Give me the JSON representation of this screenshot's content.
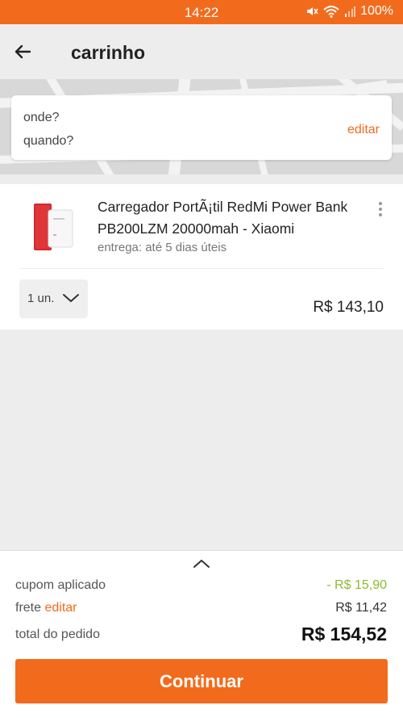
{
  "status_bar": {
    "time": "14:22",
    "battery": "100%"
  },
  "header": {
    "title": "carrinho",
    "back_icon": "arrow-left-icon"
  },
  "location": {
    "where_label": "onde?",
    "when_label": "quando?",
    "edit_label": "editar"
  },
  "product": {
    "name": "Carregador PortÃ¡til RedMi Power Bank PB200LZM 20000mah - Xiaomi",
    "delivery": "entrega: até 5 dias úteis",
    "quantity": "1 un.",
    "price": "R$ 143,10"
  },
  "summary": {
    "coupon_label": "cupom aplicado",
    "coupon_value": "- R$ 15,90",
    "shipping_label": "frete",
    "shipping_edit": "editar",
    "shipping_value": "R$ 11,42",
    "total_label": "total do pedido",
    "total_value": "R$ 154,52",
    "continue_label": "Continuar"
  },
  "colors": {
    "accent": "#f26b1d",
    "discount": "#8bbb2e",
    "background": "#ededed"
  }
}
